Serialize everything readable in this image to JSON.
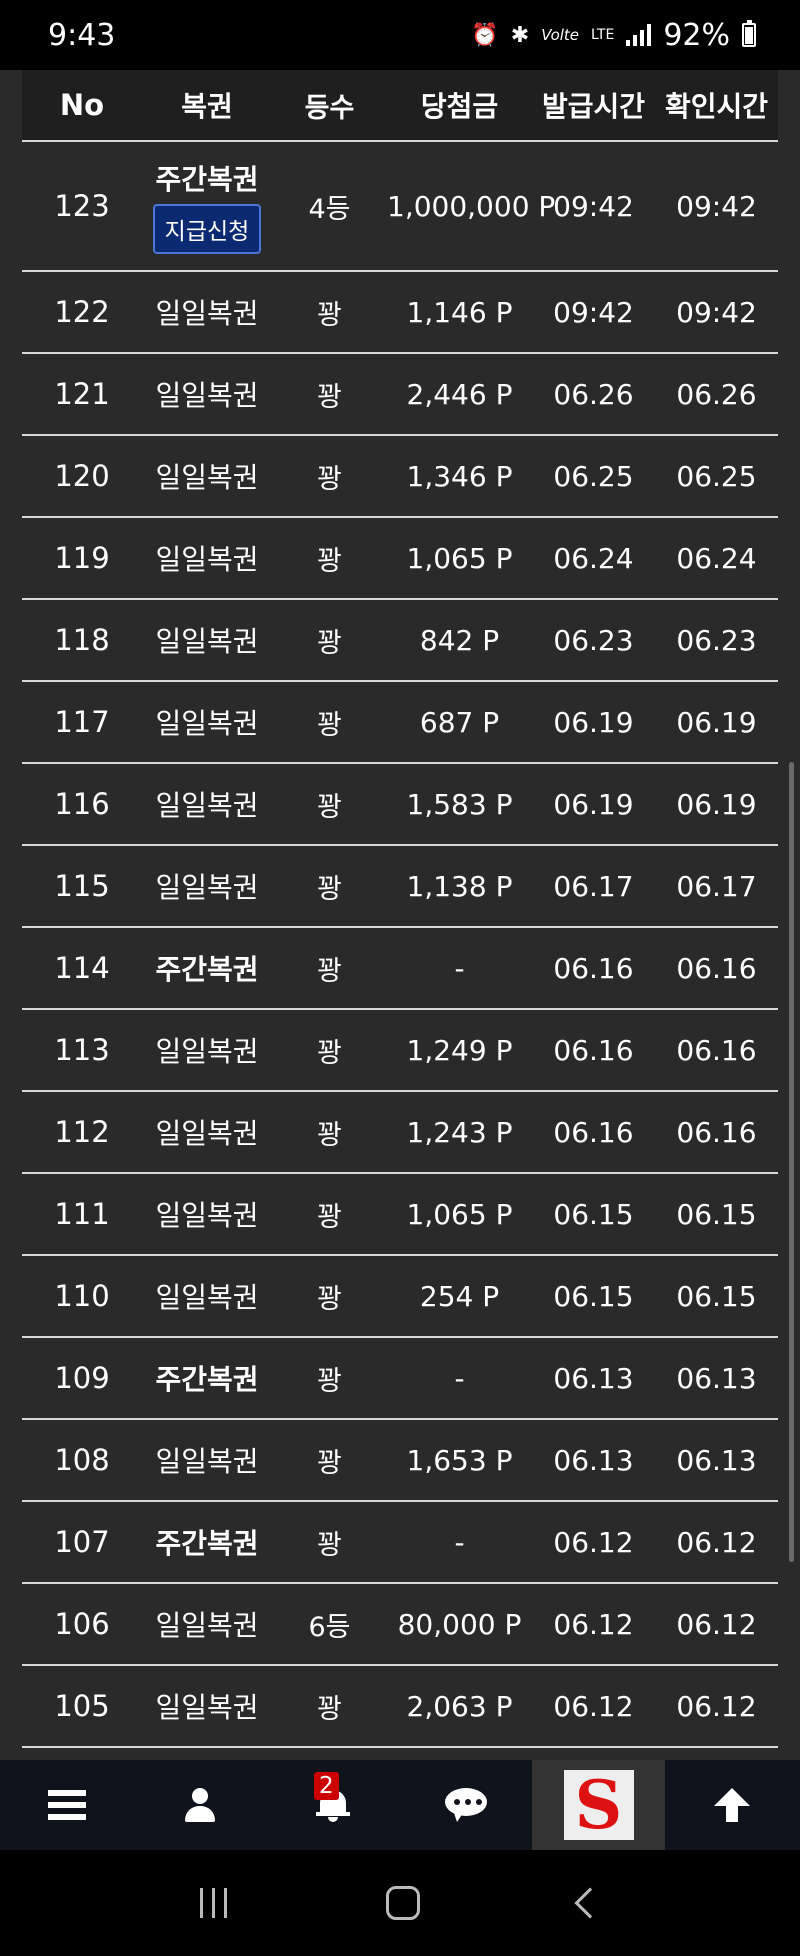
{
  "status_bar": {
    "time": "9:43",
    "network": "LTE",
    "volte": "Volte",
    "battery": "92%",
    "icons": [
      "alarm-icon",
      "bluetooth-icon",
      "volte-icon",
      "lte-icon",
      "signal-icon",
      "battery-icon"
    ]
  },
  "table": {
    "headers": [
      "No",
      "복권",
      "등수",
      "당첨금",
      "발급시간",
      "확인시간"
    ],
    "first_row": {
      "no": "123",
      "kind": "주간복권",
      "apply_label": "지급신청",
      "rank": "4등",
      "prize": "1,000,000",
      "prize_overlap": "P",
      "issued": "09:42",
      "checked": "09:42"
    },
    "rows": [
      {
        "no": "122",
        "kind": "일일복권",
        "rank": "꽝",
        "prize": "1,146 P",
        "issued": "09:42",
        "checked": "09:42"
      },
      {
        "no": "121",
        "kind": "일일복권",
        "rank": "꽝",
        "prize": "2,446 P",
        "issued": "06.26",
        "checked": "06.26"
      },
      {
        "no": "120",
        "kind": "일일복권",
        "rank": "꽝",
        "prize": "1,346 P",
        "issued": "06.25",
        "checked": "06.25"
      },
      {
        "no": "119",
        "kind": "일일복권",
        "rank": "꽝",
        "prize": "1,065 P",
        "issued": "06.24",
        "checked": "06.24"
      },
      {
        "no": "118",
        "kind": "일일복권",
        "rank": "꽝",
        "prize": "842 P",
        "issued": "06.23",
        "checked": "06.23"
      },
      {
        "no": "117",
        "kind": "일일복권",
        "rank": "꽝",
        "prize": "687 P",
        "issued": "06.19",
        "checked": "06.19"
      },
      {
        "no": "116",
        "kind": "일일복권",
        "rank": "꽝",
        "prize": "1,583 P",
        "issued": "06.19",
        "checked": "06.19"
      },
      {
        "no": "115",
        "kind": "일일복권",
        "rank": "꽝",
        "prize": "1,138 P",
        "issued": "06.17",
        "checked": "06.17"
      },
      {
        "no": "114",
        "kind": "주간복권",
        "rank": "꽝",
        "prize": "-",
        "issued": "06.16",
        "checked": "06.16"
      },
      {
        "no": "113",
        "kind": "일일복권",
        "rank": "꽝",
        "prize": "1,249 P",
        "issued": "06.16",
        "checked": "06.16"
      },
      {
        "no": "112",
        "kind": "일일복권",
        "rank": "꽝",
        "prize": "1,243 P",
        "issued": "06.16",
        "checked": "06.16"
      },
      {
        "no": "111",
        "kind": "일일복권",
        "rank": "꽝",
        "prize": "1,065 P",
        "issued": "06.15",
        "checked": "06.15"
      },
      {
        "no": "110",
        "kind": "일일복권",
        "rank": "꽝",
        "prize": "254 P",
        "issued": "06.15",
        "checked": "06.15"
      },
      {
        "no": "109",
        "kind": "주간복권",
        "rank": "꽝",
        "prize": "-",
        "issued": "06.13",
        "checked": "06.13"
      },
      {
        "no": "108",
        "kind": "일일복권",
        "rank": "꽝",
        "prize": "1,653 P",
        "issued": "06.13",
        "checked": "06.13"
      },
      {
        "no": "107",
        "kind": "주간복권",
        "rank": "꽝",
        "prize": "-",
        "issued": "06.12",
        "checked": "06.12"
      },
      {
        "no": "106",
        "kind": "일일복권",
        "rank": "6등",
        "prize": "80,000 P",
        "issued": "06.12",
        "checked": "06.12"
      },
      {
        "no": "105",
        "kind": "일일복권",
        "rank": "꽝",
        "prize": "2,063 P",
        "issued": "06.12",
        "checked": "06.12"
      }
    ]
  },
  "bottom_nav": {
    "items": [
      "menu-icon",
      "user-icon",
      "notification-icon",
      "chat-icon",
      "site-logo",
      "scroll-top-icon"
    ],
    "notification_count": "2",
    "logo_letter": "S"
  },
  "colors": {
    "page_bg": "#2a2a2a",
    "header_bg": "#1f1f1f",
    "row_divider": "#d8d8d8",
    "apply_button": "#0b2a72",
    "badge": "#cc0000",
    "nav_bg": "#10131c"
  }
}
